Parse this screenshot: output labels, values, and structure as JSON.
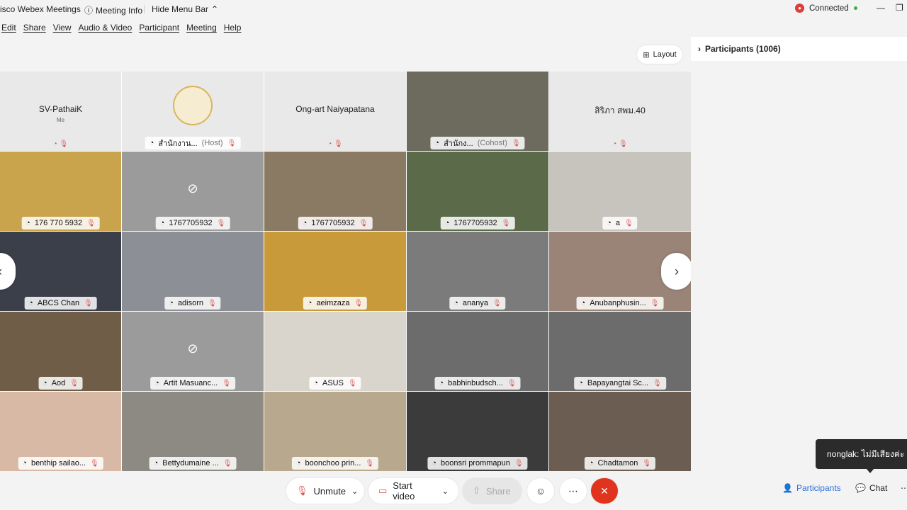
{
  "titlebar": {
    "app_title": "isco Webex Meetings",
    "meeting_info": "Meeting Info",
    "hide_menu": "Hide Menu Bar",
    "status": "Connected"
  },
  "menu": [
    "Edit",
    "Share",
    "View",
    "Audio & Video",
    "Participant",
    "Meeting",
    "Help"
  ],
  "layout_label": "Layout",
  "panel": {
    "title": "Participants (1006)"
  },
  "tiles": [
    {
      "name": "SV-PathaiK",
      "sub": "Me",
      "bg": "#e9e9e9"
    },
    {
      "name": "สำนักงาน...",
      "role": "(Host)",
      "bg": "#e9e9e9"
    },
    {
      "name": "Ong-art Naiyapatana",
      "bg": "#e9e9e9"
    },
    {
      "name": "สำนักง...",
      "role": "(Cohost)",
      "bg": "#6d6a5e"
    },
    {
      "name": "สิริภา สพม.40",
      "bg": "#e9e9e9"
    },
    {
      "name": "176 770 5932",
      "bg": "#c9a44c"
    },
    {
      "name": "1767705932",
      "bg": "#9b9b9b"
    },
    {
      "name": "1767705932",
      "bg": "#8a7a63"
    },
    {
      "name": "1767705932",
      "bg": "#5b6b4a"
    },
    {
      "name": "a",
      "bg": "#c7c3bd"
    },
    {
      "name": "ABCS Chan",
      "bg": "#3b3f4a"
    },
    {
      "name": "adisorn",
      "bg": "#8c8f95"
    },
    {
      "name": "aeimzaza",
      "bg": "#c89a3a"
    },
    {
      "name": "ananya",
      "bg": "#7b7b7b"
    },
    {
      "name": "Anubanphusin...",
      "bg": "#9a8478"
    },
    {
      "name": "Aod",
      "bg": "#6f5d48"
    },
    {
      "name": "Artit Masuanc...",
      "bg": "#9b9b9b"
    },
    {
      "name": "ASUS",
      "bg": "#d9d4cc"
    },
    {
      "name": "babhinbudsch...",
      "bg": "#6c6c6c"
    },
    {
      "name": "Bapayangtai Sc...",
      "bg": "#6c6c6c"
    },
    {
      "name": "benthip sailao...",
      "bg": "#d8b9a5"
    },
    {
      "name": "Bettydumaine ...",
      "bg": "#8d8a84"
    },
    {
      "name": "boonchoo prin...",
      "bg": "#b8a98e"
    },
    {
      "name": "boonsri prommapun",
      "bg": "#3b3b3b"
    },
    {
      "name": "Chadtamon",
      "bg": "#6b5d52"
    }
  ],
  "controls": {
    "unmute": "Unmute",
    "start_video": "Start video",
    "share": "Share",
    "participants_tab": "Participants",
    "chat_tab": "Chat"
  },
  "tooltip": "nonglak: ไม่มีเสียงค่ะ"
}
